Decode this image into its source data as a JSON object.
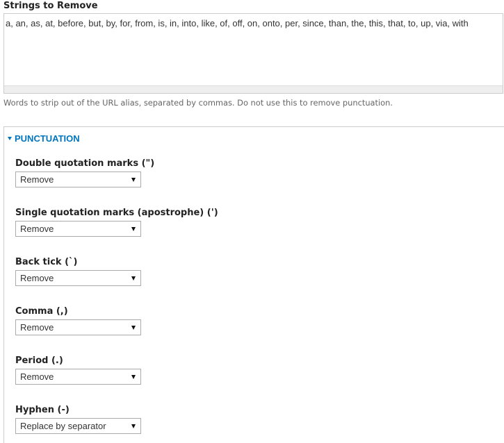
{
  "strings_to_remove": {
    "label": "Strings to Remove",
    "value": "a, an, as, at, before, but, by, for, from, is, in, into, like, of, off, on, onto, per, since, than, the, this, that, to, up, via, with",
    "description": "Words to strip out of the URL alias, separated by commas. Do not use this to remove punctuation."
  },
  "punctuation": {
    "legend": "PUNCTUATION",
    "fields": [
      {
        "label": "Double quotation marks (\")",
        "selected": "Remove"
      },
      {
        "label": "Single quotation marks (apostrophe) (')",
        "selected": "Remove"
      },
      {
        "label": "Back tick (`)",
        "selected": "Remove"
      },
      {
        "label": "Comma (,)",
        "selected": "Remove"
      },
      {
        "label": "Period (.)",
        "selected": "Remove"
      },
      {
        "label": "Hyphen (-)",
        "selected": "Replace by separator"
      }
    ]
  },
  "colors": {
    "accent": "#0074bd",
    "border": "#cccccc",
    "help_text": "#666666"
  }
}
